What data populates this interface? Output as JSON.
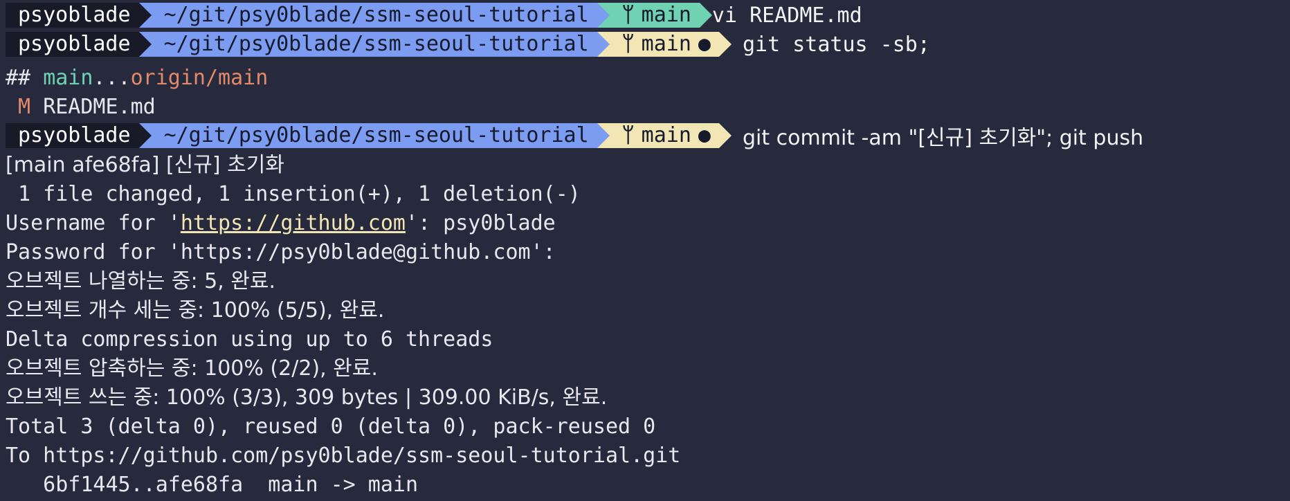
{
  "prompts": [
    {
      "user": "psyoblade",
      "path": "~/git/psy0blade/ssm-seoul-tutorial",
      "branch": "main",
      "dirty": false,
      "command": "vi README.md"
    },
    {
      "user": "psyoblade",
      "path": "~/git/psy0blade/ssm-seoul-tutorial",
      "branch": "main",
      "dirty": true,
      "command": "git status -sb;"
    },
    {
      "user": "psyoblade",
      "path": "~/git/psy0blade/ssm-seoul-tutorial",
      "branch": "main",
      "dirty": true,
      "command": "git commit -am \"[신규] 초기화\"; git push"
    }
  ],
  "icons": {
    "branch": "git-branch-icon",
    "dirty": "dirty-dot-icon"
  },
  "status": {
    "hash_prefix": "## ",
    "local_branch": "main",
    "separator": "...",
    "remote_branch": "origin/main",
    "mod_flag": " M ",
    "mod_file": "README.md"
  },
  "output": {
    "commit_line": "[main afe68fa] [신규] 초기화",
    "changes_line": " 1 file changed, 1 insertion(+), 1 deletion(-)",
    "username_prefix": "Username for '",
    "username_link": "https://github.com",
    "username_suffix": "': psy0blade",
    "password_line": "Password for 'https://psy0blade@github.com':",
    "enum_line": "오브젝트 나열하는 중: 5, 완료.",
    "count_line": "오브젝트 개수 세는 중: 100% (5/5), 완료.",
    "delta_line": "Delta compression using up to 6 threads",
    "compress_line": "오브젝트 압축하는 중: 100% (2/2), 완료.",
    "write_line": "오브젝트 쓰는 중: 100% (3/3), 309 bytes | 309.00 KiB/s, 완료.",
    "total_line": "Total 3 (delta 0), reused 0 (delta 0), pack-reused 0",
    "to_line": "To https://github.com/psy0blade/ssm-seoul-tutorial.git",
    "ref_line": "   6bf1445..afe68fa  main -> main"
  },
  "colors": {
    "background": "#272a3d",
    "user_segment": "#181a28",
    "path_segment": "#7b9cf0",
    "git_clean_segment": "#6fd3b3",
    "git_dirty_segment": "#f1e6b4",
    "remote_branch_text": "#e38a6a"
  }
}
